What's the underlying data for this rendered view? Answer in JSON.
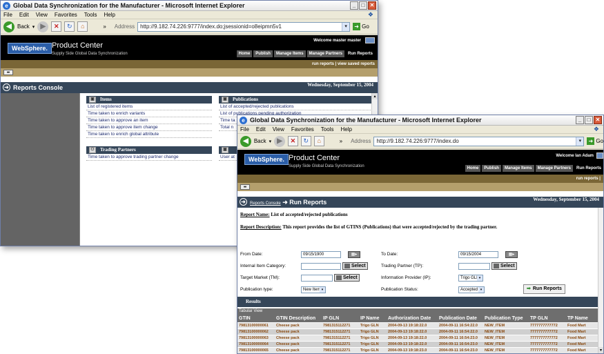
{
  "browser": {
    "title": "Global Data Synchronization for the Manufacturer - Microsoft Internet Explorer",
    "menu": [
      "File",
      "Edit",
      "View",
      "Favorites",
      "Tools",
      "Help"
    ],
    "back_label": "Back",
    "address_label": "Address",
    "go_label": "Go"
  },
  "win1": {
    "url": "http://9.182.74.226:9777/index.do;jsessionid=o8eipmn5v1",
    "welcome": "Welcome  master master",
    "console_title": "Reports Console",
    "date": "Wednesday, September 15, 2004",
    "items_head": "Items",
    "items": [
      "List of registered items",
      "Time taken to enrich variants",
      "Time taken to approve an item",
      "Time taken to approve item change",
      "Time taken to enrich global attribute"
    ],
    "partners_head": "Trading Partners",
    "partners": [
      "Time taken to approve trading partner change"
    ],
    "pubs_head": "Publications",
    "pubs": [
      "List of accepted/rejected publications",
      "List of publications pending authorization",
      "Time ta",
      "Total n"
    ],
    "user_fragment": "User at"
  },
  "app": {
    "logo": "WebSphere.",
    "product": "Product Center",
    "product_sub": "Supply Side Global Data Synchronization",
    "nav": [
      "Home",
      "Publish",
      "Manage Items",
      "Manage Partners",
      "Run Reports"
    ],
    "subnav": "run reports  |  view saved reports"
  },
  "win2": {
    "url": "http://9.182.74.226:9777/index.do",
    "welcome": "Welcome  Ian Adam",
    "subnav": "run reports  |",
    "breadcrumb_link": "Reports Console",
    "breadcrumb_current": "Run Reports",
    "date": "Wednesday, September 15, 2004",
    "report_name_label": "Report Name:",
    "report_name": "List of accepted/rejected publications",
    "report_desc_label": "Report Description:",
    "report_desc": "This report provides the list of GTINS (Publications) that were accepted/rejected by the trading partner.",
    "form": {
      "from_date_label": "From Date:",
      "from_date": "09/15/1900",
      "to_date_label": "To Date:",
      "to_date": "09/15/2004",
      "internal_cat_label": "Internal Item Category:",
      "trading_partner_label": "Trading Partner (TP):",
      "target_market_label": "Target Market (TM):",
      "info_provider_label": "Information Provider (IP):",
      "info_provider": "Trigo GLN",
      "pub_type_label": "Publication type:",
      "pub_type": "New Item",
      "pub_status_label": "Publication Status:",
      "pub_status": "Accepted",
      "select_label": "Select",
      "run_label": "Run Reports"
    },
    "results_label": "Results",
    "tabular_label": "Tabular View",
    "columns": [
      "GTIN",
      "GTIN Description",
      "IP GLN",
      "IP Name",
      "Authorization Date",
      "Publication Date",
      "Publication Type",
      "TP GLN",
      "TP Name"
    ],
    "rows": [
      [
        "79813100000061",
        "Cheese pack",
        "7981315112271",
        "Trigo GLN",
        "2004-09-13 19:18:22.0",
        "2004-09-11 16:54:22.0",
        "NEW_ITEM",
        "7777777777772",
        "Food Mart"
      ],
      [
        "79813100000062",
        "Cheese pack",
        "7981315112271",
        "Trigo GLN",
        "2004-09-13 19:18:22.0",
        "2004-09-11 16:54:22.0",
        "NEW_ITEM",
        "7777777777772",
        "Food Mart"
      ],
      [
        "79813100000063",
        "Cheese pack",
        "7981315112271",
        "Trigo GLN",
        "2004-09-13 19:18:22.0",
        "2004-09-11 16:54:23.0",
        "NEW_ITEM",
        "7777777777772",
        "Food Mart"
      ],
      [
        "79813100000064",
        "Cheese pack",
        "7981315112271",
        "Trigo GLN",
        "2004-09-13 19:18:22.0",
        "2004-09-11 16:54:23.0",
        "NEW_ITEM",
        "7777777777772",
        "Food Mart"
      ],
      [
        "79813100000065",
        "Cheese pack",
        "7981315112271",
        "Trigo GLN",
        "2004-09-13 19:18:23.0",
        "2004-09-11 16:54:23.0",
        "NEW_ITEM",
        "7777777777772",
        "Food Mart"
      ]
    ]
  }
}
